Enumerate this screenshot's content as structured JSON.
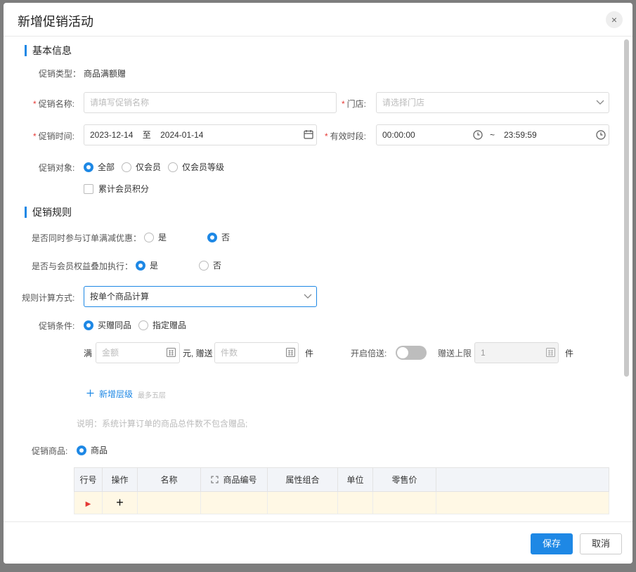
{
  "dialog": {
    "title": "新增促销活动",
    "close_glyph": "×"
  },
  "basic_info": {
    "section_title": "基本信息",
    "promo_type_label": "促销类型：",
    "promo_type_value": "商品满额赠",
    "promo_name_label": "促销名称:",
    "promo_name_placeholder": "请填写促销名称",
    "store_label": "门店:",
    "store_placeholder": "请选择门店",
    "promo_time_label": "促销时间:",
    "date_start": "2023-12-14",
    "date_sep": "至",
    "date_end": "2024-01-14",
    "valid_period_label": "有效时段:",
    "time_start": "00:00:00",
    "time_sep": "~",
    "time_end": "23:59:59",
    "target_label": "促销对象:",
    "target_options": [
      "全部",
      "仅会员",
      "仅会员等级"
    ],
    "target_selected": "全部",
    "accumulate_points_label": "累计会员积分",
    "accumulate_points_checked": false
  },
  "rules": {
    "section_title": "促销规则",
    "order_discount_label": "是否同时参与订单满减优惠：",
    "order_discount_options": [
      "是",
      "否"
    ],
    "order_discount_selected": "否",
    "member_benefit_label": "是否与会员权益叠加执行：",
    "member_benefit_options": [
      "是",
      "否"
    ],
    "member_benefit_selected": "是",
    "calc_method_label": "规则计算方式:",
    "calc_method_value": "按单个商品计算",
    "condition_label": "促销条件:",
    "condition_options": [
      "买赠同品",
      "指定赠品"
    ],
    "condition_selected": "买赠同品",
    "full_label": "满",
    "amount_placeholder": "金额",
    "yuan_gift_label": "元, 赠送",
    "count_placeholder": "件数",
    "piece_label": "件",
    "multiple_label": "开启倍送:",
    "multiple_enabled": false,
    "gift_limit_label": "赠送上限",
    "gift_limit_value": "1",
    "piece_label2": "件",
    "add_level_label": "新增层级",
    "add_level_hint": "最多五层",
    "note": "说明：系统计算订单的商品总件数不包含赠品;",
    "goods_label": "促销商品:",
    "goods_option": "商品",
    "table_headers": [
      "行号",
      "操作",
      "名称",
      "商品编号",
      "属性组合",
      "单位",
      "零售价",
      ""
    ]
  },
  "footer": {
    "save_label": "保存",
    "cancel_label": "取消"
  },
  "colors": {
    "accent": "#1e88e5",
    "required": "#e53935",
    "row_highlight": "#fff8e5"
  },
  "icons": {
    "calendar": "calendar-icon",
    "clock": "clock-icon",
    "chevron": "chevron-down-icon",
    "plus": "plus-icon",
    "stepper": "calculator-icon"
  }
}
